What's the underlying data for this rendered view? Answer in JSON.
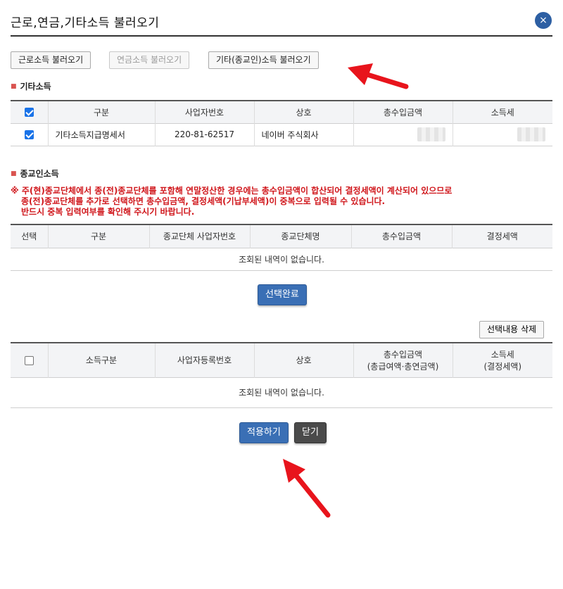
{
  "header": {
    "title": "근로,연금,기타소득 불러오기",
    "close_icon": "×"
  },
  "load_buttons": [
    {
      "label": "근로소득 불러오기",
      "enabled": true
    },
    {
      "label": "연금소득 불러오기",
      "enabled": false
    },
    {
      "label": "기타(종교인)소득 불러오기",
      "enabled": true
    }
  ],
  "other_income": {
    "section_title": "기타소득",
    "columns": [
      "구분",
      "사업자번호",
      "상호",
      "총수입금액",
      "소득세"
    ],
    "rows": [
      {
        "checked": true,
        "type": "기타소득지급명세서",
        "biz_no": "220-81-62517",
        "company": "네이버 주식회사"
      }
    ]
  },
  "religious_income": {
    "section_title": "종교인소득",
    "notice": [
      "※ 주(현)종교단체에서 종(전)종교단체를 포함해 연말정산한 경우에는 총수입금액이 합산되어 결정세액이 계산되어 있으므로",
      "종(전)종교단체를 추가로 선택하면 총수입금액, 결정세액(기납부세액)이 중복으로 입력될 수 있습니다.",
      "반드시 중복 입력여부를 확인해 주시기 바랍니다."
    ],
    "columns": [
      "선택",
      "구분",
      "종교단체 사업자번호",
      "종교단체명",
      "총수입금액",
      "결정세액"
    ],
    "empty_text": "조회된 내역이 없습니다.",
    "select_done_label": "선택완료"
  },
  "summary": {
    "delete_label": "선택내용 삭제",
    "columns": [
      "소득구분",
      "사업자등록번호",
      "상호",
      "총수입금액",
      "소득세"
    ],
    "column_subs": {
      "total": "(총급여액·총연금액)",
      "tax": "(결정세액)"
    },
    "empty_text": "조회된 내역이 없습니다."
  },
  "footer": {
    "apply_label": "적용하기",
    "close_label": "닫기"
  },
  "colors": {
    "primary": "#3a6fb5",
    "notice": "#d0161b",
    "arrow": "#e8141c",
    "checkbox": "#1a73e8"
  }
}
